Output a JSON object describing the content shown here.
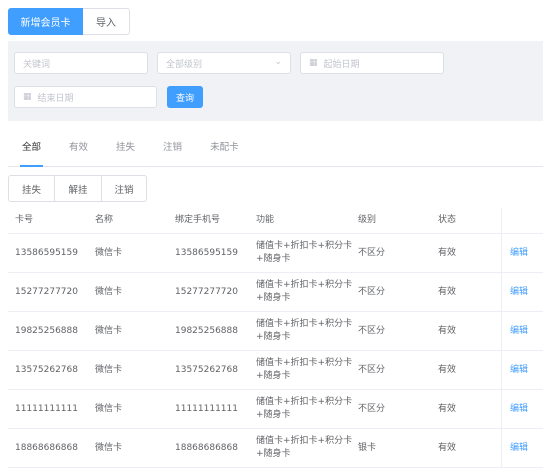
{
  "toolbar": {
    "add_label": "新增会员卡",
    "import_label": "导入"
  },
  "filters": {
    "keyword_placeholder": "关键词",
    "level_placeholder": "全部级别",
    "start_date_placeholder": "起始日期",
    "end_date_placeholder": "结束日期",
    "query_label": "查询"
  },
  "tabs": [
    "全部",
    "有效",
    "挂失",
    "注销",
    "未配卡"
  ],
  "actions": [
    "挂失",
    "解挂",
    "注销"
  ],
  "table": {
    "columns": [
      "卡号",
      "名称",
      "绑定手机号",
      "功能",
      "级别",
      "状态"
    ],
    "rows": [
      {
        "card": "13586595159",
        "name": "微信卡",
        "phone": "13586595159",
        "func1": "储值卡+折扣卡+积分卡",
        "func2": "+随身卡",
        "level": "不区分",
        "status": "有效",
        "action": "编辑"
      },
      {
        "card": "15277277720",
        "name": "微信卡",
        "phone": "15277277720",
        "func1": "储值卡+折扣卡+积分卡",
        "func2": "+随身卡",
        "level": "不区分",
        "status": "有效",
        "action": "编辑"
      },
      {
        "card": "19825256888",
        "name": "微信卡",
        "phone": "19825256888",
        "func1": "储值卡+折扣卡+积分卡",
        "func2": "+随身卡",
        "level": "不区分",
        "status": "有效",
        "action": "编辑"
      },
      {
        "card": "13575262768",
        "name": "微信卡",
        "phone": "13575262768",
        "func1": "储值卡+折扣卡+积分卡",
        "func2": "+随身卡",
        "level": "不区分",
        "status": "有效",
        "action": "编辑"
      },
      {
        "card": "11111111111",
        "name": "微信卡",
        "phone": "11111111111",
        "func1": "储值卡+折扣卡+积分卡",
        "func2": "+随身卡",
        "level": "不区分",
        "status": "有效",
        "action": "编辑"
      },
      {
        "card": "18868686868",
        "name": "微信卡",
        "phone": "18868686868",
        "func1": "储值卡+折扣卡+积分卡",
        "func2": "+随身卡",
        "level": "银卡",
        "status": "有效",
        "action": "编辑"
      }
    ]
  },
  "colors": {
    "primary": "#409eff",
    "panel_bg": "#f0f2f5",
    "border": "#dcdfe6"
  }
}
